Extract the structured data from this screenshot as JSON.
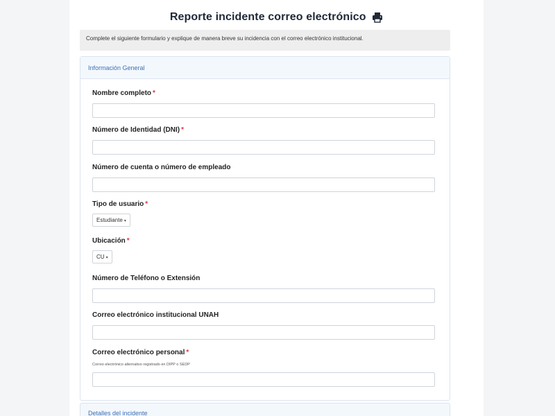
{
  "header": {
    "title": "Reporte incidente correo electrónico",
    "print_icon": "print-icon"
  },
  "intro": {
    "text": "Complete el siguiente formulario y explique de manera breve su incidencia con el correo electrónico institucional."
  },
  "general_section": {
    "title": "Información General",
    "required_mark": "*",
    "fields": {
      "nombre": {
        "label": "Nombre completo",
        "value": ""
      },
      "dni": {
        "label": "Número de Identidad (DNI)",
        "value": ""
      },
      "cuenta": {
        "label": "Número de cuenta o número de empleado",
        "value": ""
      },
      "tipo_usuario": {
        "label": "Tipo de usuario",
        "selected": "Estudiante"
      },
      "ubicacion": {
        "label": "Ubicación",
        "selected": "CU"
      },
      "telefono": {
        "label": "Número de Teléfono o Extensión",
        "value": ""
      },
      "correo_institucional": {
        "label": "Correo electrónico institucional UNAH",
        "value": ""
      },
      "correo_personal": {
        "label": "Correo electrónico personal",
        "help": "Correo electrónico alternativo registrado en DIPP o SEDP",
        "value": ""
      }
    }
  },
  "details_section": {
    "title": "Detalles del incidente"
  },
  "colors": {
    "accent": "#3f6fb0",
    "required": "#dc3545",
    "page_bg": "#f4f5f7"
  }
}
